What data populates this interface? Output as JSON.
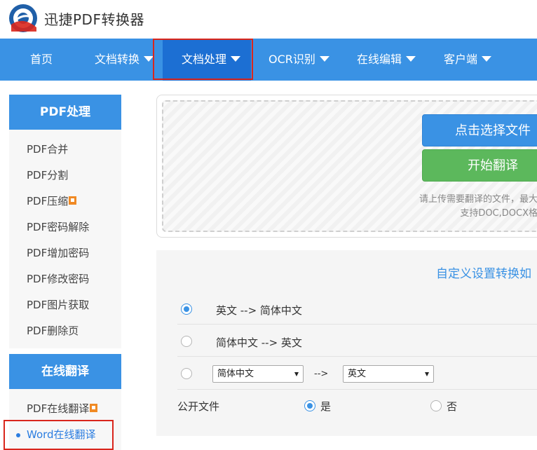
{
  "app": {
    "title": "迅捷PDF转换器"
  },
  "nav": {
    "items": [
      {
        "label": "首页",
        "dropdown": false
      },
      {
        "label": "文档转换",
        "dropdown": true
      },
      {
        "label": "文档处理",
        "dropdown": true,
        "active": true
      },
      {
        "label": "OCR识别",
        "dropdown": true
      },
      {
        "label": "在线编辑",
        "dropdown": true
      },
      {
        "label": "客户端",
        "dropdown": true
      }
    ]
  },
  "sidebar": {
    "pdf_section": {
      "title": "PDF处理",
      "items": [
        {
          "label": "PDF合并"
        },
        {
          "label": "PDF分割"
        },
        {
          "label": "PDF压缩",
          "badge": "hot"
        },
        {
          "label": "PDF密码解除"
        },
        {
          "label": "PDF增加密码"
        },
        {
          "label": "PDF修改密码"
        },
        {
          "label": "PDF图片获取"
        },
        {
          "label": "PDF删除页"
        }
      ]
    },
    "translate_section": {
      "title": "在线翻译",
      "items": [
        {
          "label": "PDF在线翻译",
          "badge": "hot"
        },
        {
          "label": "Word在线翻译",
          "active": true
        }
      ]
    }
  },
  "upload": {
    "select_button": "点击选择文件",
    "translate_button": "开始翻译",
    "hint_line1": "请上传需要翻译的文件，最大支",
    "hint_line2": "支持DOC,DOCX格式"
  },
  "settings": {
    "title": "自定义设置转换如",
    "option1": "英文 --> 简体中文",
    "option2": "简体中文 --> 英文",
    "custom_from": "简体中文",
    "custom_arrow": "-->",
    "custom_to": "英文",
    "public_label": "公开文件",
    "public_yes": "是",
    "public_no": "否"
  },
  "colors": {
    "primary": "#3a92e4",
    "nav_active": "#1c6fd3",
    "success": "#5cb85c",
    "highlight": "#d9261c"
  }
}
